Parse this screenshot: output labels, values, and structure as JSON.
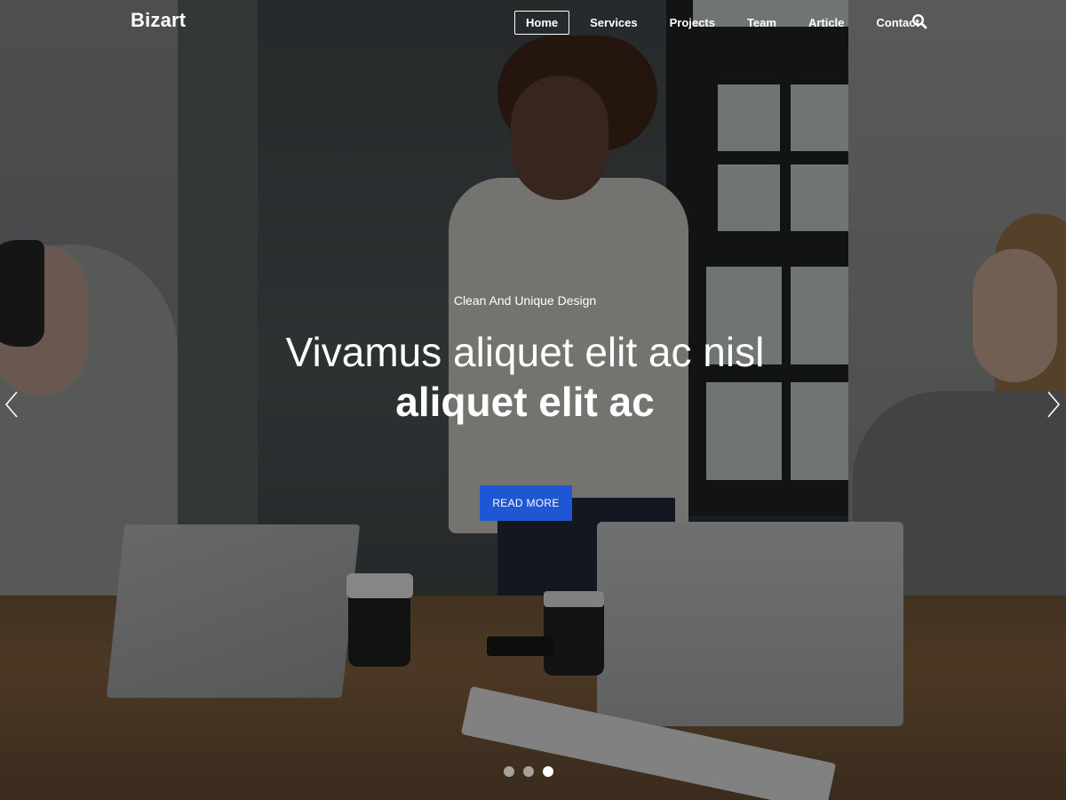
{
  "header": {
    "logo": "Bizart",
    "nav": [
      {
        "label": "Home",
        "active": true
      },
      {
        "label": "Services",
        "active": false
      },
      {
        "label": "Projects",
        "active": false
      },
      {
        "label": "Team",
        "active": false
      },
      {
        "label": "Article",
        "active": false
      },
      {
        "label": "Contact",
        "active": false
      }
    ],
    "search_icon": "search-icon"
  },
  "hero": {
    "subtitle": "Clean And Unique Design",
    "headline_line1": "Vivamus aliquet elit ac nisl",
    "headline_line2": "aliquet elit ac",
    "cta_label": "READ MORE",
    "cta_color": "#1f56d3",
    "prev_icon": "chevron-left-icon",
    "next_icon": "chevron-right-icon"
  },
  "slider": {
    "slide_count": 3,
    "active_index": 2
  }
}
